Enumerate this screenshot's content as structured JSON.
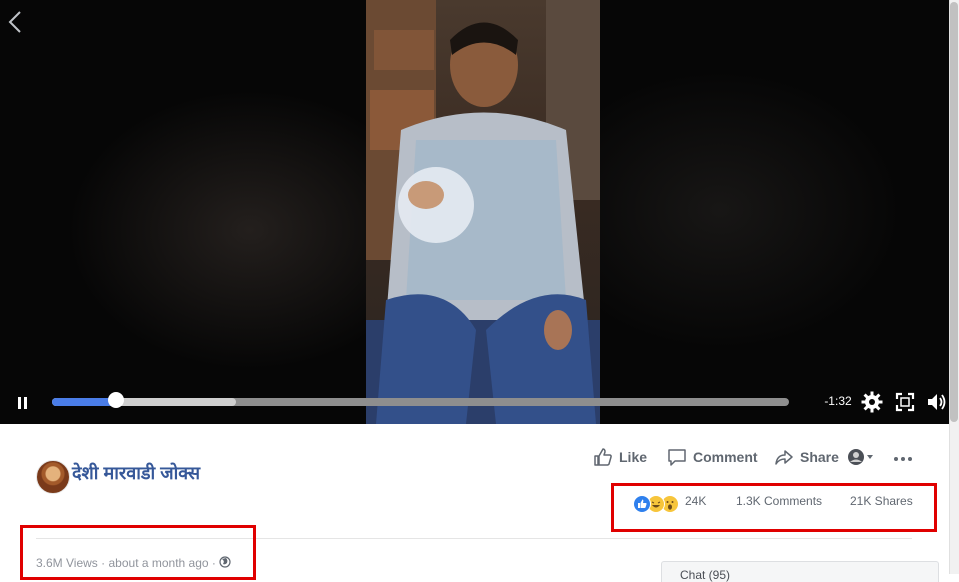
{
  "video": {
    "controls": {
      "remaining_time": "-1:32",
      "played_fraction": 0.087,
      "buffered_fraction": 0.25
    }
  },
  "post": {
    "page_name": "देशी मारवाडी जोक्स",
    "actions": {
      "like_label": "Like",
      "comment_label": "Comment",
      "share_label": "Share"
    },
    "stats": {
      "reaction_icons": [
        "like",
        "haha",
        "wow"
      ],
      "reaction_count": "24K",
      "comments": "1.3K Comments",
      "shares": "21K Shares"
    },
    "meta": {
      "views": "3.6M Views",
      "separator": "·",
      "time_ago": "about a month ago",
      "privacy": "globe-icon"
    }
  },
  "chat": {
    "label": "Chat (95)"
  },
  "colors": {
    "link": "#365899",
    "progress": "#4a7de8",
    "annotation": "#e00000"
  }
}
